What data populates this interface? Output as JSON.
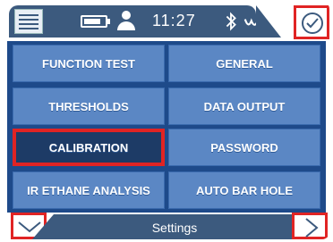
{
  "status": {
    "time": "11:27",
    "icons": [
      "menu-icon",
      "battery-icon",
      "user-icon",
      "bluetooth-icon",
      "signal-icon",
      "check-icon"
    ]
  },
  "menu": {
    "items": [
      {
        "label": "FUNCTION TEST"
      },
      {
        "label": "GENERAL"
      },
      {
        "label": "THRESHOLDS"
      },
      {
        "label": "DATA OUTPUT"
      },
      {
        "label": "CALIBRATION",
        "selected": true
      },
      {
        "label": "PASSWORD"
      },
      {
        "label": "IR ETHANE ANALYSIS"
      },
      {
        "label": "AUTO BAR HOLE"
      }
    ]
  },
  "footer": {
    "title": "Settings"
  },
  "colors": {
    "header": "#3c5a7e",
    "tile": "#5b87c4",
    "tile_selected": "#1d3b66",
    "highlight": "#e02424"
  }
}
